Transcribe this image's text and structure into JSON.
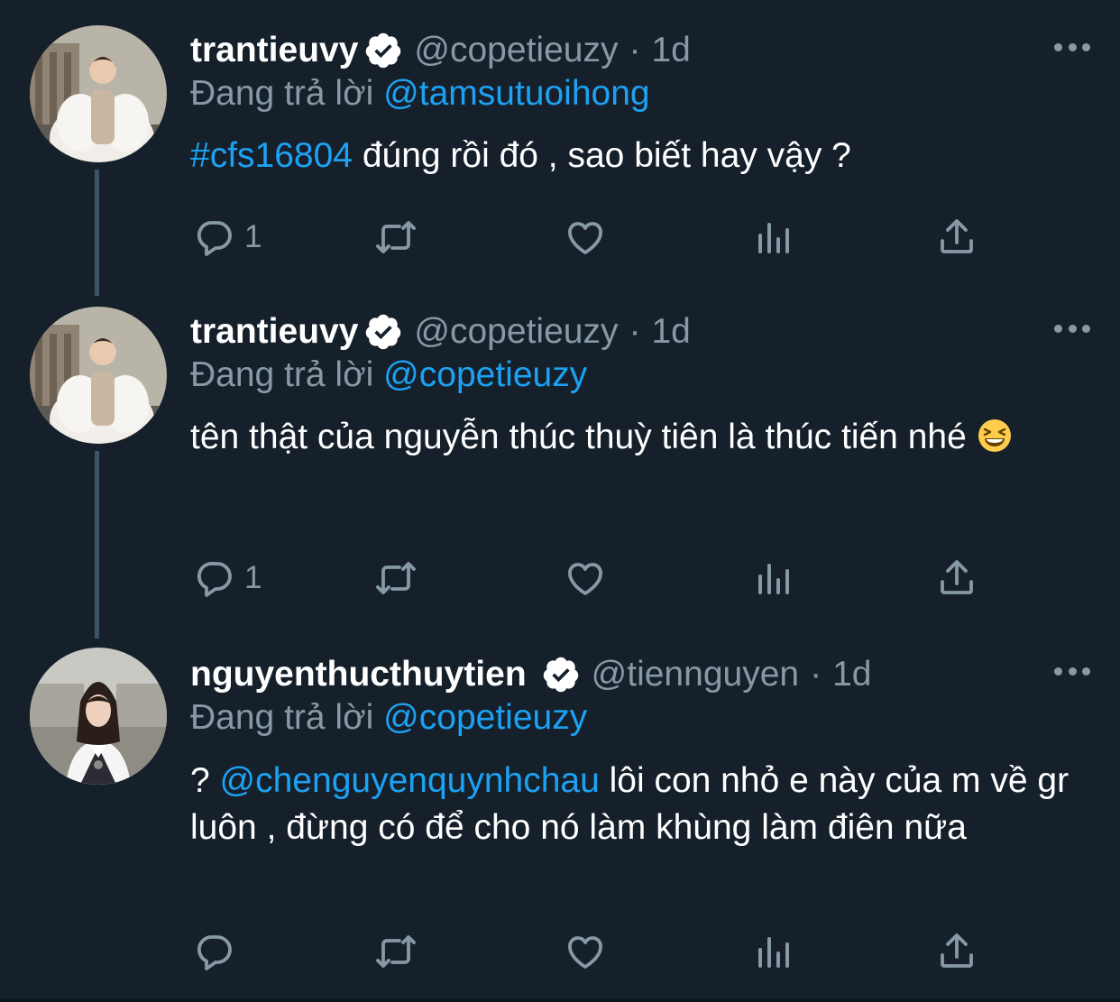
{
  "tweets": [
    {
      "name": "trantieuvy",
      "handle": "@copetieuzy",
      "separator": "·",
      "time": "1d",
      "reply_prefix": "Đang trả lời",
      "reply_to": "@tamsutuoihong",
      "hashtag": "#cfs16804",
      "text": " đúng rồi đó , sao biết hay vậy ?",
      "reply_count": "1",
      "avatar_icon": "profile-photo-woman-white-fur"
    },
    {
      "name": "trantieuvy",
      "handle": "@copetieuzy",
      "separator": "·",
      "time": "1d",
      "reply_prefix": "Đang trả lời",
      "reply_to": "@copetieuzy",
      "text": "tên thật của nguyễn thúc thuỳ tiên là thúc tiến nhé",
      "emoji": "grinning-squinting-face-emoji",
      "reply_count": "1",
      "avatar_icon": "profile-photo-woman-white-fur"
    },
    {
      "name": "nguyenthucthuytien",
      "handle": "@tiennguyen",
      "separator": "·",
      "time": "1d",
      "reply_prefix": "Đang trả lời",
      "reply_to": "@copetieuzy",
      "text_prefix": "? ",
      "text_mention": "@chenguyenquynhchau",
      "text": " lôi con nhỏ e này của m về gr luôn , đừng có để cho nó làm khùng làm điên nữa",
      "reply_count": "",
      "avatar_icon": "profile-photo-woman-sweater-vest"
    }
  ],
  "icons": {
    "reply": "reply-icon",
    "retweet": "retweet-icon",
    "like": "like-icon",
    "analytics": "analytics-icon",
    "share": "share-icon",
    "verified": "verified-badge-icon",
    "more": "more-icon"
  },
  "colors": {
    "background": "#15202b",
    "text": "#ffffff",
    "muted": "#8899a6",
    "link": "#1da1f2",
    "thread_line": "#3d5466"
  }
}
